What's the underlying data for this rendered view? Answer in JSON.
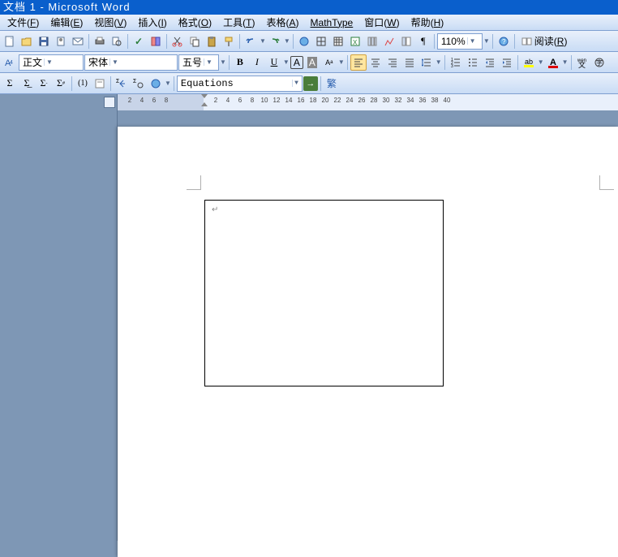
{
  "title": "文档 1 - Microsoft Word",
  "menus": [
    {
      "label": "文件",
      "acc": "F"
    },
    {
      "label": "编辑",
      "acc": "E"
    },
    {
      "label": "视图",
      "acc": "V"
    },
    {
      "label": "插入",
      "acc": "I"
    },
    {
      "label": "格式",
      "acc": "O"
    },
    {
      "label": "工具",
      "acc": "T"
    },
    {
      "label": "表格",
      "acc": "A"
    },
    {
      "label": "MathType",
      "acc": ""
    },
    {
      "label": "窗口",
      "acc": "W"
    },
    {
      "label": "帮助",
      "acc": "H"
    }
  ],
  "toolbar1": {
    "zoom": "110%",
    "read_label": "阅读",
    "read_acc": "R"
  },
  "toolbar2": {
    "style": "正文",
    "font": "宋体",
    "size": "五号"
  },
  "toolbar3": {
    "equations": "Equations",
    "fan": "繁"
  },
  "ruler_ticks": [
    2,
    4,
    6,
    8,
    2,
    4,
    6,
    8,
    10,
    12,
    14,
    16,
    18,
    20,
    22,
    24,
    26,
    28,
    30,
    32,
    34,
    36,
    38,
    40
  ],
  "para_mark": "↵"
}
